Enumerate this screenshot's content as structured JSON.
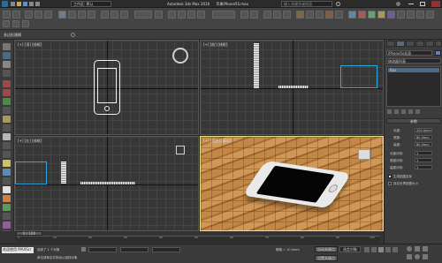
{
  "titlebar": {
    "app_title": "Autodesk 3ds Max 2016",
    "file_name": "苹果iPhone5S.max",
    "workspace_label": "工作区: 默认",
    "search_placeholder": "键入关键字或短语"
  },
  "ribbon": {
    "label": "多边形建模"
  },
  "viewports": {
    "top_left": {
      "label": "[+] [顶] [线框]"
    },
    "top_right": {
      "label": "[+] [前] [线框]"
    },
    "bottom_left": {
      "label": "[+] [左] [线框]"
    },
    "bottom_right": {
      "label": "[+] [透视] [真实]"
    }
  },
  "command_panel": {
    "object_name": "iPhone5s机身",
    "modifier_list_label": "修改器列表",
    "stack_item": "Box",
    "rollout_title": "参数",
    "params": [
      {
        "label": "长度:",
        "value": "200.0mm"
      },
      {
        "label": "宽度:",
        "value": "80.0mm"
      },
      {
        "label": "高度:",
        "value": "80.0mm"
      },
      {
        "label": "长度分段:",
        "value": "1"
      },
      {
        "label": "宽度分段:",
        "value": "1"
      },
      {
        "label": "高度分段:",
        "value": "1"
      }
    ],
    "checkboxes": [
      {
        "label": "生成贴图坐标",
        "checked": true
      },
      {
        "label": "真实世界贴图大小",
        "checked": false
      }
    ]
  },
  "timeline": {
    "frame_counter": "0 / 100",
    "ticks": [
      "0",
      "10",
      "20",
      "30",
      "40",
      "50",
      "60",
      "70",
      "80",
      "90",
      "100"
    ]
  },
  "statusbar": {
    "left_text": "欢迎使用 MAXScr",
    "selection_text": "选择了 1 个对象",
    "hint_text": "单击或单击并拖动以选择对象",
    "grid_text": "栅格 = 10.0mm",
    "autokey_label": "自动关键点",
    "setkey_label": "设置关键点",
    "selected_label": "选定对象"
  },
  "colors": {
    "accent_active": "#e4e488",
    "selected_box": "#2fa8e0"
  }
}
